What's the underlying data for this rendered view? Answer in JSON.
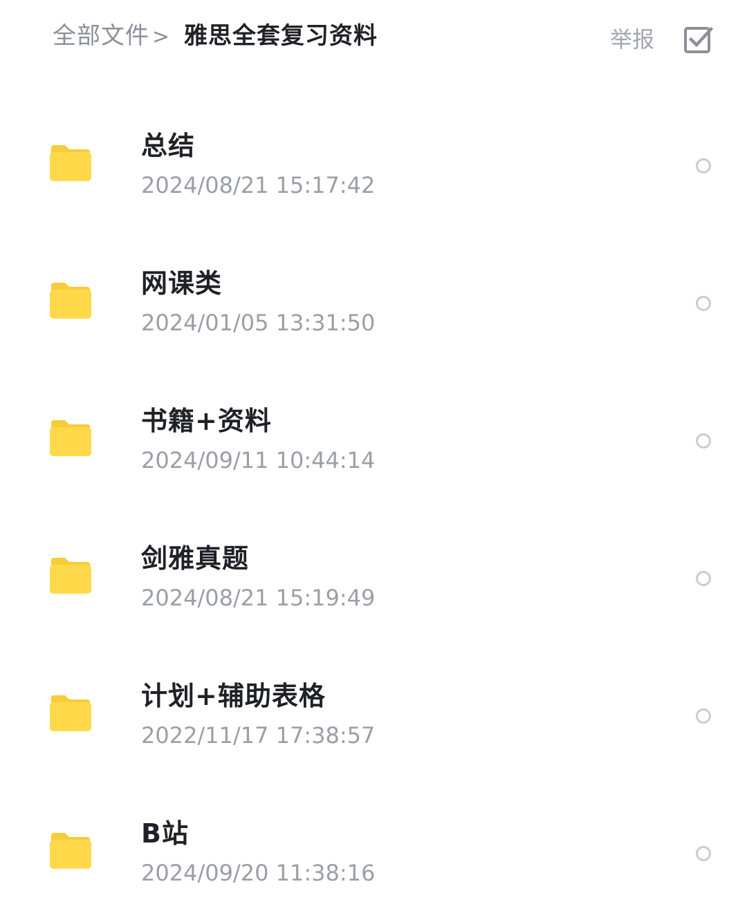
{
  "header": {
    "breadcrumb_root": "全部文件",
    "breadcrumb_separator": ">",
    "breadcrumb_current": "雅思全套复习资料",
    "report_label": "举报",
    "select_all_icon": "checkbox-checked-icon"
  },
  "colors": {
    "folder": "#FFD94A",
    "folder_tab": "#F7CC3A",
    "text_primary": "#1F2126",
    "text_secondary": "#9A9EA6",
    "radio_border": "#C9CCD1"
  },
  "files": [
    {
      "name": "总结",
      "date": "2024/08/21 15:17:42",
      "icon": "folder-icon"
    },
    {
      "name": "网课类",
      "date": "2024/01/05 13:31:50",
      "icon": "folder-icon"
    },
    {
      "name": "书籍+资料",
      "date": "2024/09/11 10:44:14",
      "icon": "folder-icon"
    },
    {
      "name": "剑雅真题",
      "date": "2024/08/21 15:19:49",
      "icon": "folder-icon"
    },
    {
      "name": "计划+辅助表格",
      "date": "2022/11/17 17:38:57",
      "icon": "folder-icon"
    },
    {
      "name": "B站",
      "date": "2024/09/20 11:38:16",
      "icon": "folder-icon"
    }
  ]
}
